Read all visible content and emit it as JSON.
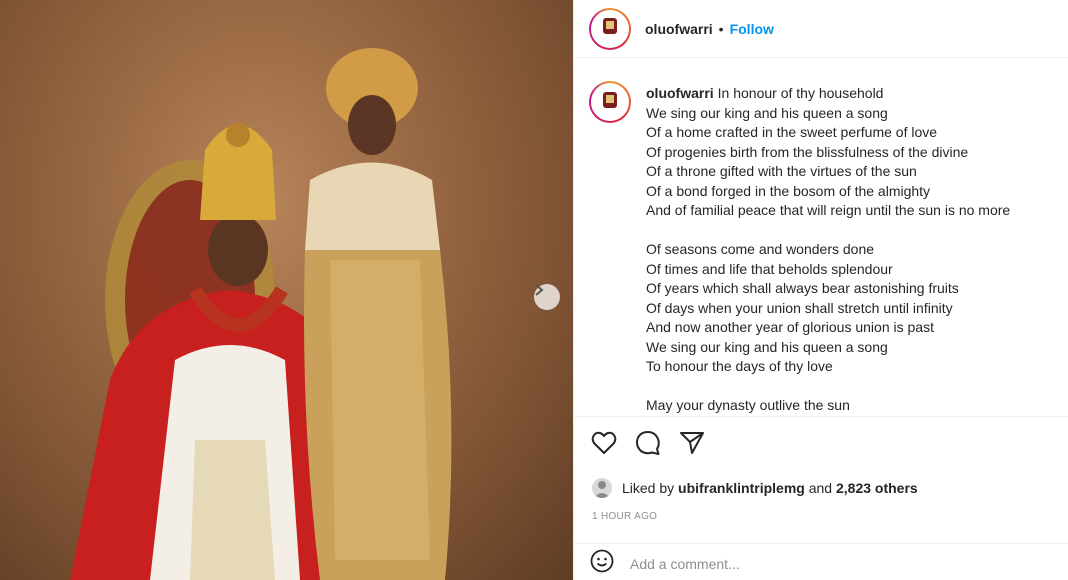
{
  "post": {
    "photo_alt": "Couple portrait",
    "next_label": "Next"
  },
  "header": {
    "username": "oluofwarri",
    "separator": "•",
    "follow_label": "Follow"
  },
  "caption": {
    "username": "oluofwarri",
    "lines": [
      "In honour of thy household",
      "We sing our king and his queen a song",
      "Of a home crafted in the sweet perfume of love",
      "Of progenies birth from the blissfulness of the divine",
      "Of a throne gifted with the virtues of the sun",
      "Of a bond forged in the bosom of the almighty",
      "And of familial peace that will reign until the sun is no more",
      "",
      "Of seasons come and wonders done",
      "Of times and life that beholds splendour",
      "Of years which shall always bear astonishing fruits",
      "Of days when your union shall stretch until infinity",
      "And now another year of glorious union is past",
      "We sing our king and his queen a song",
      "To honour the days of thy love",
      "",
      "May your dynasty outlive the sun"
    ]
  },
  "likes": {
    "prefix": "Liked by",
    "user": "ubifranklintriplemg",
    "conjunction": "and",
    "count": "2,823 others"
  },
  "timestamp": "1 HOUR AGO",
  "comment": {
    "placeholder": "Add a comment..."
  },
  "colors": {
    "accent": "#0095f6",
    "text": "#262626",
    "muted": "#8e8e8e",
    "divider": "#efefef"
  },
  "icons": [
    "heart-icon",
    "comment-icon",
    "share-icon",
    "emoji-icon",
    "chevron-right-icon"
  ]
}
